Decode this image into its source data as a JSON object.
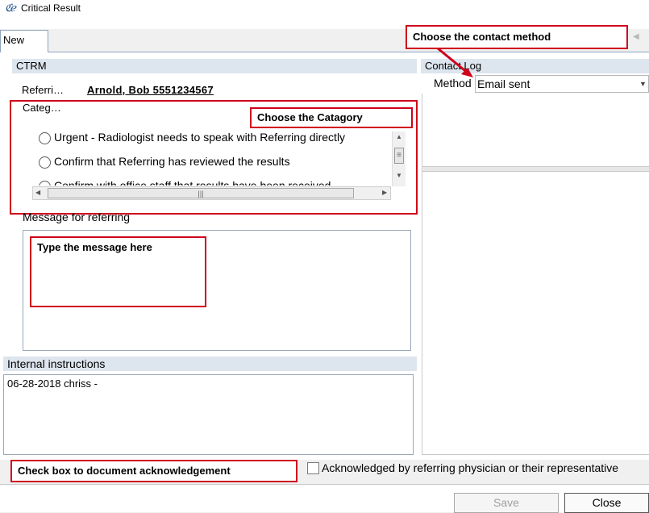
{
  "window": {
    "title": "Critical Result",
    "icon": "critical-result-app-icon"
  },
  "tabs": [
    {
      "label": "New"
    }
  ],
  "ctrm": {
    "header": "CTRM",
    "referring_label": "Referri…",
    "referring_value": "Arnold, Bob  5551234567",
    "category_label": "Categ…",
    "categories": [
      {
        "label": "Urgent - Radiologist needs to speak with Referring directly"
      },
      {
        "label": "Confirm that Referring has reviewed the results"
      },
      {
        "label": "Confirm with office staff that results have been received"
      }
    ],
    "message_label": "Message for referring",
    "message_value": "",
    "internal_label": "Internal instructions",
    "internal_value": "06-28-2018 chriss -"
  },
  "contact_log": {
    "header": "Contact Log",
    "method_label": "Method",
    "method_value": "Email sent"
  },
  "acknowledgement": {
    "label": "Acknowledged by referring physician or their representative",
    "checked": false
  },
  "buttons": {
    "save": "Save",
    "close": "Close"
  },
  "annotations": {
    "contact_method": "Choose the contact method",
    "category": "Choose the Catagory",
    "message": "Type the message here",
    "acknowledge": "Check box to document acknowledgement"
  },
  "colors": {
    "annotation_red": "#d0021b",
    "section_header_bg": "#dde5ee",
    "disabled_text": "#a0a0a0"
  }
}
